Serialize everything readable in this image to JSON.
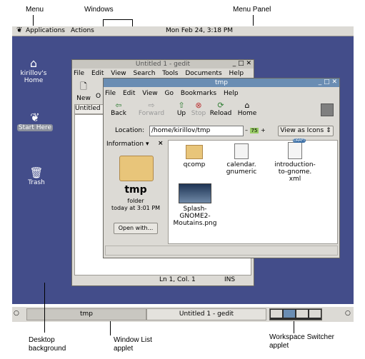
{
  "callouts": {
    "menu": "Menu",
    "windows": "Windows",
    "menu_panel": "Menu Panel",
    "desktop_background": "Desktop\nbackground",
    "window_list_applet": "Window List\napplet",
    "workspace_switcher_applet": "Workspace Switcher\napplet"
  },
  "menu_panel": {
    "applications": "Applications",
    "actions": "Actions",
    "clock": "Mon Feb 24,  3:18 PM"
  },
  "desktop_icons": {
    "home": "kirillov's\nHome",
    "start_here": "Start Here",
    "trash": "Trash"
  },
  "gedit": {
    "title": "Untitled 1 - gedit",
    "menu": [
      "File",
      "Edit",
      "View",
      "Search",
      "Tools",
      "Documents",
      "Help"
    ],
    "new_label": "New",
    "open_label_partial": "O",
    "tab_label": "Untitled",
    "status_position": "Ln 1, Col. 1",
    "status_mode": "INS"
  },
  "nautilus": {
    "title": "tmp",
    "menu": [
      "File",
      "Edit",
      "View",
      "Go",
      "Bookmarks",
      "Help"
    ],
    "toolbar": {
      "back": "Back",
      "forward": "Forward",
      "up": "Up",
      "stop": "Stop",
      "reload": "Reload",
      "home": "Home"
    },
    "location_label": "Location:",
    "location_value": "/home/kirillov/tmp",
    "zoom_value": "75",
    "view_as": "View as Icons",
    "sidebar_mode": "Information",
    "sidebar_close": "×",
    "folder_name": "tmp",
    "folder_type": "folder",
    "folder_date": "today at 3:01 PM",
    "open_with": "Open with...",
    "files": [
      {
        "name": "qcomp",
        "icon": "folder-icon"
      },
      {
        "name": "calendar.\ngnumeric",
        "icon": "spreadsheet-icon"
      },
      {
        "name": "introduction-\nto-gnome.\nxml",
        "icon": "xml-draft-icon",
        "badge": "DRAFT"
      },
      {
        "name": "Splash-\nGNOME2-\nMoutains.png",
        "icon": "image-thumbnail-icon"
      }
    ]
  },
  "bottom_panel": {
    "task_tmp": "tmp",
    "task_gedit": "Untitled 1 - gedit"
  },
  "colors": {
    "desktop": "#434d8a",
    "panel": "#dcdad5",
    "active_title": "#6a8db3",
    "inactive_title": "#c8c6c0"
  }
}
